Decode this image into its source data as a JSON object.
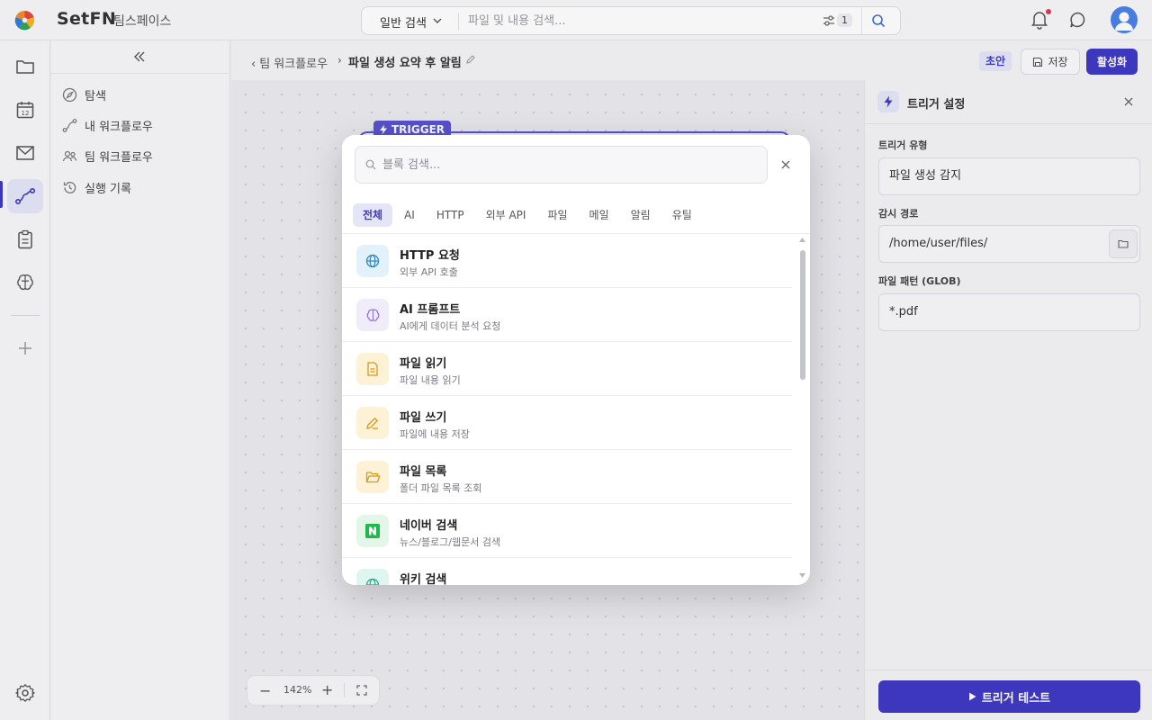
{
  "app": {
    "brand": "SetFN",
    "workspace": "팀스페이스"
  },
  "topbar": {
    "search_mode": "일반 검색",
    "search_placeholder": "파일 및 내용 검색...",
    "filter_count": "1"
  },
  "sidebar": {
    "items": [
      {
        "label": "탐색",
        "icon": "compass-icon"
      },
      {
        "label": "내 워크플로우",
        "icon": "workflow-icon"
      },
      {
        "label": "팀 워크플로우",
        "icon": "team-icon"
      },
      {
        "label": "실행 기록",
        "icon": "history-icon"
      }
    ]
  },
  "rail": {
    "calendar_day": "12"
  },
  "breadcrumb": {
    "back_label": "팀 워크플로우",
    "separator": "›",
    "title": "파일 생성 요약 후 알림",
    "status": "초안",
    "save_label": "저장",
    "activate_label": "활성화"
  },
  "canvas": {
    "trigger_tag": "TRIGGER",
    "zoom_level": "142%",
    "zoom_minus": "−",
    "zoom_plus": "+"
  },
  "right_panel": {
    "title": "트리거 설정",
    "trigger_type_label": "트리거 유형",
    "trigger_type_value": "파일 생성 감지",
    "watch_path_label": "감시 경로",
    "watch_path_value": "/home/user/files/",
    "pattern_label": "파일 패턴 (GLOB)",
    "pattern_value": "*.pdf",
    "test_button": "트리거 테스트"
  },
  "modal": {
    "search_placeholder": "블록 검색...",
    "tabs": [
      "전체",
      "AI",
      "HTTP",
      "외부 API",
      "파일",
      "메일",
      "알림",
      "유틸"
    ],
    "active_tab": "전체",
    "blocks": [
      {
        "name": "HTTP 요청",
        "desc": "외부 API 호출",
        "icon": "globe-icon",
        "bg": "#e3f1fb",
        "fg": "#2b86c5"
      },
      {
        "name": "AI 프롬프트",
        "desc": "AI에게 데이터 분석 요청",
        "icon": "brain-icon",
        "bg": "#f0ecfa",
        "fg": "#8a6cd4"
      },
      {
        "name": "파일 읽기",
        "desc": "파일 내용 읽기",
        "icon": "file-icon",
        "bg": "#fdf1d6",
        "fg": "#d99a1c"
      },
      {
        "name": "파일 쓰기",
        "desc": "파일에 내용 저장",
        "icon": "pencil-icon",
        "bg": "#fdf1d6",
        "fg": "#d99a1c"
      },
      {
        "name": "파일 목록",
        "desc": "폴더 파일 목록 조회",
        "icon": "folder-open-icon",
        "bg": "#fdf1d6",
        "fg": "#d99a1c"
      },
      {
        "name": "네이버 검색",
        "desc": "뉴스/블로그/웹문서 검색",
        "icon": "naver-icon",
        "bg": "#e3f6e8",
        "fg": "#1fb84b"
      },
      {
        "name": "위키 검색",
        "desc": "",
        "icon": "globe-icon",
        "bg": "#dff5f0",
        "fg": "#2aa889"
      }
    ]
  },
  "colors": {
    "accent": "#3f39c4",
    "accent_light": "#e4e6f8",
    "notification": "#e0365a"
  }
}
